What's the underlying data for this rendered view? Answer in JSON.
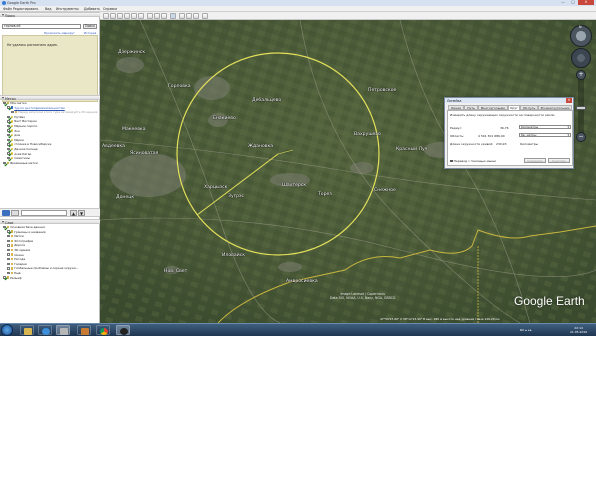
{
  "window": {
    "title": "Google Earth Pro",
    "minimize": "—",
    "maximize": "□",
    "close": "✕"
  },
  "menu": [
    "Файл",
    "Редактировать",
    "Вид",
    "Инструменты",
    "Добавить",
    "Справка"
  ],
  "search": {
    "header": "Поиск",
    "query": "горлов.кб",
    "button": "Поиск",
    "link_directions": "Проложить маршрут",
    "link_history": "История",
    "message": "Не удалось распознать адрес."
  },
  "places": {
    "header": "Метки",
    "items": [
      {
        "label": "Мои метки",
        "checked": true,
        "level": 0,
        "kind": "folder"
      },
      {
        "label": "Тур по достопримечательностям",
        "checked": true,
        "level": 1,
        "kind": "link"
      },
      {
        "label": "Перед запуском этого тура активируйте 3D-здания",
        "checked": false,
        "level": 2,
        "kind": "muted"
      },
      {
        "label": "Путёво",
        "checked": true,
        "level": 1,
        "kind": "pin"
      },
      {
        "label": "Бахт Вистерин",
        "checked": true,
        "level": 1,
        "kind": "pin"
      },
      {
        "label": "Марьин пороги",
        "checked": true,
        "level": 1,
        "kind": "pin"
      },
      {
        "label": "Зон",
        "checked": true,
        "level": 1,
        "kind": "pin"
      },
      {
        "label": "дом",
        "checked": true,
        "level": 1,
        "kind": "pin"
      },
      {
        "label": "Марка",
        "checked": true,
        "level": 1,
        "kind": "pin"
      },
      {
        "label": "стоянка в Новосибирске",
        "checked": true,
        "level": 1,
        "kind": "pin"
      },
      {
        "label": "Дачное Солнце",
        "checked": true,
        "level": 1,
        "kind": "pin"
      },
      {
        "label": "Азия Катар",
        "checked": true,
        "level": 1,
        "kind": "pin"
      },
      {
        "label": "Симитины",
        "checked": true,
        "level": 1,
        "kind": "pin"
      },
      {
        "label": "Временные метки",
        "checked": true,
        "level": 0,
        "kind": "folder"
      }
    ]
  },
  "layers": {
    "header": "Слои",
    "items": [
      {
        "label": "Основная база данных",
        "checked": true,
        "level": 0
      },
      {
        "label": "Границы и названия",
        "checked": true,
        "level": 1
      },
      {
        "label": "Метки",
        "checked": false,
        "level": 1
      },
      {
        "label": "Фотографии",
        "checked": false,
        "level": 1
      },
      {
        "label": "Дороги",
        "checked": false,
        "level": 1
      },
      {
        "label": "3D-здания",
        "checked": false,
        "level": 1
      },
      {
        "label": "Океан",
        "checked": false,
        "level": 1
      },
      {
        "label": "Погода",
        "checked": false,
        "level": 1
      },
      {
        "label": "Галерея",
        "checked": false,
        "level": 1
      },
      {
        "label": "Глобальные проблемы и охрана окружа...",
        "checked": false,
        "level": 1
      },
      {
        "label": "Ещё",
        "checked": false,
        "level": 1
      },
      {
        "label": "Рельеф",
        "checked": true,
        "level": 0
      }
    ]
  },
  "map": {
    "places": [
      {
        "name": "Дзержинск"
      },
      {
        "name": "Горловка"
      },
      {
        "name": "Дебальцево"
      },
      {
        "name": "Петровское"
      },
      {
        "name": "Енакиево"
      },
      {
        "name": "Ждановка"
      },
      {
        "name": "Вахрушево"
      },
      {
        "name": "Красный Луч"
      },
      {
        "name": "Макеевка"
      },
      {
        "name": "Авдеевка"
      },
      {
        "name": "Ясиноватая"
      },
      {
        "name": "Донецк"
      },
      {
        "name": "Харцызск"
      },
      {
        "name": "Зугрэс"
      },
      {
        "name": "Шахтерск"
      },
      {
        "name": "Торез"
      },
      {
        "name": "Снежное"
      },
      {
        "name": "Свердловск"
      },
      {
        "name": "Иловайск"
      },
      {
        "name": "Амвросиевка"
      },
      {
        "name": "Нов. Свет"
      }
    ],
    "logo": "Google Earth",
    "attribution": "Image Landsat / Copernicus\nData SIO, NOAA, U.S. Navy, NGA, GEBCO",
    "status": "47°59'27.60\" С  38°12'15.90\" В  выс. 180 м  высота над уровнем глаза 120.29 км"
  },
  "ruler": {
    "title": "Линейка",
    "close": "✕",
    "tabs": [
      "Линия",
      "Путь",
      "Многоугольник",
      "Круг",
      "3D-путь",
      "3D-многоугольник"
    ],
    "active_tab": "Круг",
    "description": "Измерить длину окружающих окружности на поверхности земли",
    "radius_label": "Радиус:",
    "radius_value": "36,76",
    "radius_unit": "Километры",
    "area_label": "Область:",
    "area_value": "4 501 301 686,00",
    "area_unit": "Кв. метры",
    "circumference_label": "Длина окружности кривой:",
    "circumference_value": "230,93",
    "circumference_unit": "Километры",
    "checkbox_label": "Перевод с помощью мыши",
    "save_label": "Сохранить",
    "clear_label": "Очистить"
  },
  "taskbar": {
    "time": "22:14",
    "date": "21.05.2016",
    "lang": "RU",
    "apps": [
      "explorer",
      "ie",
      "media",
      "chrome",
      "google-earth"
    ]
  },
  "colors": {
    "circle": "#e4e05a",
    "border_line": "#d4b84a",
    "map_base": "#4a5a3a",
    "taskbar": "#2a4562"
  }
}
